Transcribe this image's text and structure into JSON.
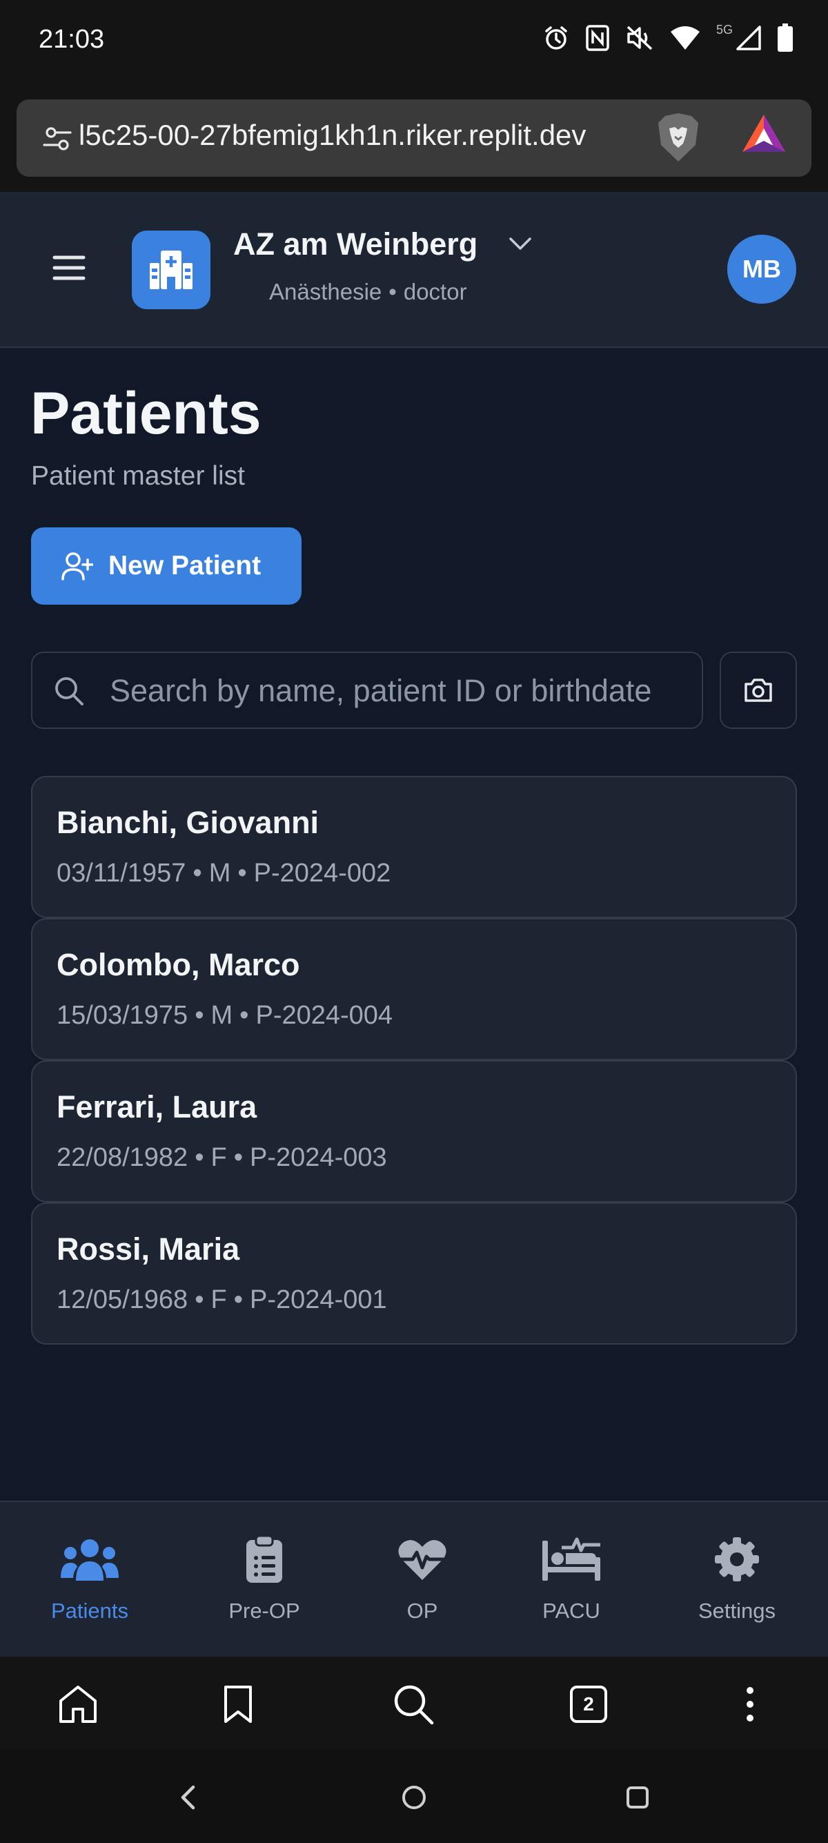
{
  "status_bar": {
    "time": "21:03",
    "network": "5G",
    "icons": [
      "alarm-icon",
      "nfc-icon",
      "mute-icon",
      "wifi-icon",
      "signal-icon",
      "battery-icon"
    ]
  },
  "browser": {
    "url": "l5c25-00-27bfemig1kh1n.riker.replit.dev",
    "tab_count": "2"
  },
  "header": {
    "org_name": "AZ am Weinberg",
    "department": "Anästhesie",
    "role": "doctor",
    "separator": "•",
    "avatar_initials": "MB"
  },
  "page": {
    "title": "Patients",
    "subtitle": "Patient master list",
    "new_patient_label": "New Patient",
    "search_placeholder": "Search by name, patient ID or birthdate"
  },
  "patients": [
    {
      "name": "Bianchi, Giovanni",
      "birthdate": "03/11/1957",
      "sex": "M",
      "id": "P-2024-002"
    },
    {
      "name": "Colombo, Marco",
      "birthdate": "15/03/1975",
      "sex": "M",
      "id": "P-2024-004"
    },
    {
      "name": "Ferrari, Laura",
      "birthdate": "22/08/1982",
      "sex": "F",
      "id": "P-2024-003"
    },
    {
      "name": "Rossi, Maria",
      "birthdate": "12/05/1968",
      "sex": "F",
      "id": "P-2024-001"
    }
  ],
  "nav": {
    "items": [
      {
        "label": "Patients",
        "icon": "users-icon",
        "active": true
      },
      {
        "label": "Pre-OP",
        "icon": "clipboard-icon",
        "active": false
      },
      {
        "label": "OP",
        "icon": "heartbeat-icon",
        "active": false
      },
      {
        "label": "PACU",
        "icon": "bed-pulse-icon",
        "active": false
      },
      {
        "label": "Settings",
        "icon": "gear-icon",
        "active": false
      }
    ]
  },
  "colors": {
    "accent": "#3b82e0",
    "background": "#111827",
    "surface": "#1e2532",
    "active_nav": "#4a8be8"
  }
}
